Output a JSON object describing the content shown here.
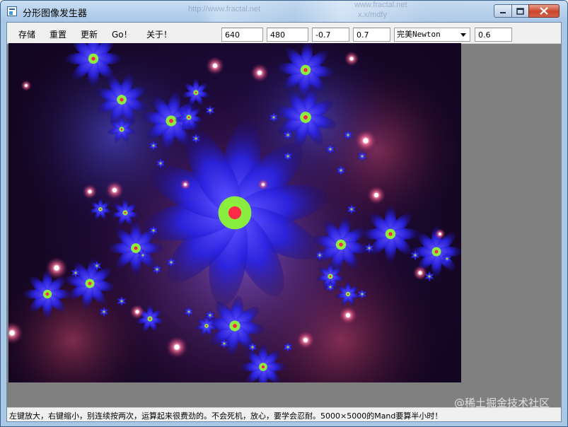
{
  "window": {
    "title": "分形图像发生器"
  },
  "background_titles": [
    "http://www.fractal.net",
    "www.fractal.net",
    "x.x/mdfy"
  ],
  "menu": {
    "items": [
      "存储",
      "重置",
      "更新",
      "Go！",
      "关于！"
    ]
  },
  "toolbar": {
    "width": "640",
    "height": "480",
    "center_x": "-0.7",
    "center_y": "0.7",
    "fractal_type": "完美Newton",
    "param": "0.6"
  },
  "status": {
    "text": "左键放大，右键缩小，别连续按两次，运算起来很费劲的。不会死机，放心，要学会忍耐。5000×5000的Mand要算半小时！"
  },
  "watermark": "@稀土掘金技术社区",
  "colors": {
    "petal_blue": "#3a3cff",
    "petal_light": "#8e7bff",
    "center_green": "#8fff2a",
    "center_red": "#ff2a4a",
    "glow_pink": "#ff6f9a",
    "background_dark": "#1a0930",
    "gray_bg": "#808080"
  }
}
